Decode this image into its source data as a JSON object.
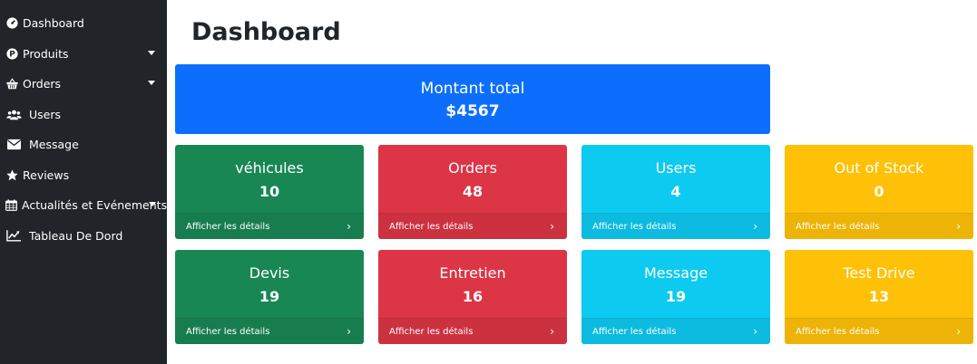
{
  "sidebar": {
    "items": [
      {
        "label": "Dashboard",
        "icon": "tachometer-icon"
      },
      {
        "label": "Produits",
        "icon": "parking-icon",
        "has_caret": true
      },
      {
        "label": "Orders",
        "icon": "shopping-basket-icon",
        "has_caret": true
      },
      {
        "label": "Users",
        "icon": "users-icon"
      },
      {
        "label": "Message",
        "icon": "envelope-icon"
      },
      {
        "label": "Reviews",
        "icon": "star-icon"
      },
      {
        "label": "Actualités et Evénements",
        "icon": "calendar-icon",
        "has_caret": true
      },
      {
        "label": "Tableau De Dord",
        "icon": "chart-line-icon"
      }
    ]
  },
  "main": {
    "title": "Dashboard",
    "total": {
      "label": "Montant total",
      "value": "$4567"
    },
    "cards": [
      {
        "title": "véhicules",
        "value": "10",
        "link": "Afficher les détails",
        "color": "#198754"
      },
      {
        "title": "Orders",
        "value": "48",
        "link": "Afficher les détails",
        "color": "#dc3545"
      },
      {
        "title": "Users",
        "value": "4",
        "link": "Afficher les détails",
        "color": "#0dcaf0"
      },
      {
        "title": "Out of Stock",
        "value": "0",
        "link": "Afficher les détails",
        "color": "#ffc107"
      },
      {
        "title": "Devis",
        "value": "19",
        "link": "Afficher les détails",
        "color": "#198754"
      },
      {
        "title": "Entretien",
        "value": "16",
        "link": "Afficher les détails",
        "color": "#dc3545"
      },
      {
        "title": "Message",
        "value": "19",
        "link": "Afficher les détails",
        "color": "#0dcaf0"
      },
      {
        "title": "Test Drive",
        "value": "13",
        "link": "Afficher les détails",
        "color": "#ffc107"
      }
    ],
    "chevron": "›"
  },
  "colors": {
    "sidebar_bg": "#212529",
    "primary": "#0d6efd",
    "success": "#198754",
    "danger": "#dc3545",
    "info": "#0dcaf0",
    "warning": "#ffc107"
  }
}
